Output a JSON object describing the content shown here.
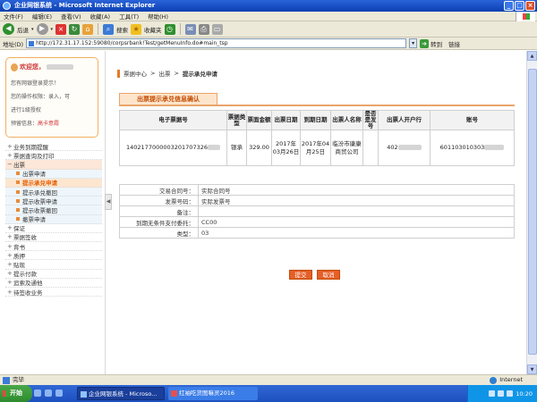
{
  "window": {
    "title": "企业网银系统 - Microsoft Internet Explorer"
  },
  "menubar": [
    "文件(F)",
    "编辑(E)",
    "查看(V)",
    "收藏(A)",
    "工具(T)",
    "帮助(H)"
  ],
  "toolbar": {
    "back": "后退",
    "search": "搜索",
    "favorites": "收藏夹"
  },
  "address": {
    "label": "地址(D)",
    "url": "http://172.31.17.152:59080/corpsrbank!Test/getMenuInfo.do#main_tsp",
    "go": "转到",
    "links": "链接"
  },
  "user": {
    "welcome": "欢迎您，",
    "last_login": "您有网银登录提示！",
    "permission": "您的操作权限：录入，可",
    "authorize": "进行1级授权",
    "reserved_prefix": "预留信息：",
    "reserved_value": "高卡意霞"
  },
  "sidebar": {
    "items": [
      {
        "label": "业务到期提醒",
        "type": "top"
      },
      {
        "label": "票据查询及打印",
        "type": "top"
      },
      {
        "label": "出票",
        "type": "active"
      },
      {
        "label": "出票申请",
        "type": "sub"
      },
      {
        "label": "提示承兑申请",
        "type": "sub-selected"
      },
      {
        "label": "提示承兑撤回",
        "type": "sub"
      },
      {
        "label": "提示收票申请",
        "type": "sub"
      },
      {
        "label": "提示收票撤回",
        "type": "sub"
      },
      {
        "label": "撤票申请",
        "type": "sub"
      },
      {
        "label": "保证",
        "type": "top"
      },
      {
        "label": "票据签收",
        "type": "top"
      },
      {
        "label": "背书",
        "type": "top"
      },
      {
        "label": "质押",
        "type": "top"
      },
      {
        "label": "贴现",
        "type": "top"
      },
      {
        "label": "提示付款",
        "type": "top"
      },
      {
        "label": "追索及通他",
        "type": "top"
      },
      {
        "label": "待签收业务",
        "type": "top"
      }
    ]
  },
  "breadcrumb": {
    "a": "票据中心",
    "sep": ">",
    "b": "出票",
    "c": "提示承兑申请"
  },
  "section": {
    "title": "出票提示承兑信息确认"
  },
  "detail_table": {
    "headers": [
      "电子票据号",
      "票据类型",
      "票面金额",
      "出票日期",
      "到期日期",
      "出票人名称",
      "是否是发号",
      "出票人开户行",
      "账号"
    ],
    "row": [
      "1402177000003201707326",
      "银承",
      "329.00",
      "2017年03月26日",
      "2017年04月25日",
      "临汾市康康商贸公司",
      "",
      "402",
      "601103010303"
    ]
  },
  "form": [
    {
      "label": "交易合同号：",
      "value": "实际合同号"
    },
    {
      "label": "发票号码：",
      "value": "实际发票号"
    },
    {
      "label": "备注：",
      "value": ""
    },
    {
      "label": "到期无条件支付委托：",
      "value": "CC00"
    },
    {
      "label": "类型：",
      "value": "03"
    }
  ],
  "buttons": {
    "submit": "提交",
    "cancel": "取消"
  },
  "statusbar": {
    "status": "完毕",
    "zone": "Internet"
  },
  "taskbar": {
    "start": "开始",
    "task1": "企业网银系统 - Microso...",
    "task2": "红袖吃货图嘛灵2016",
    "time": "10:20"
  },
  "colors": {
    "accent": "#e65f28",
    "title_bar": "#0a3fb3",
    "selected_menu": "#e35c00"
  }
}
